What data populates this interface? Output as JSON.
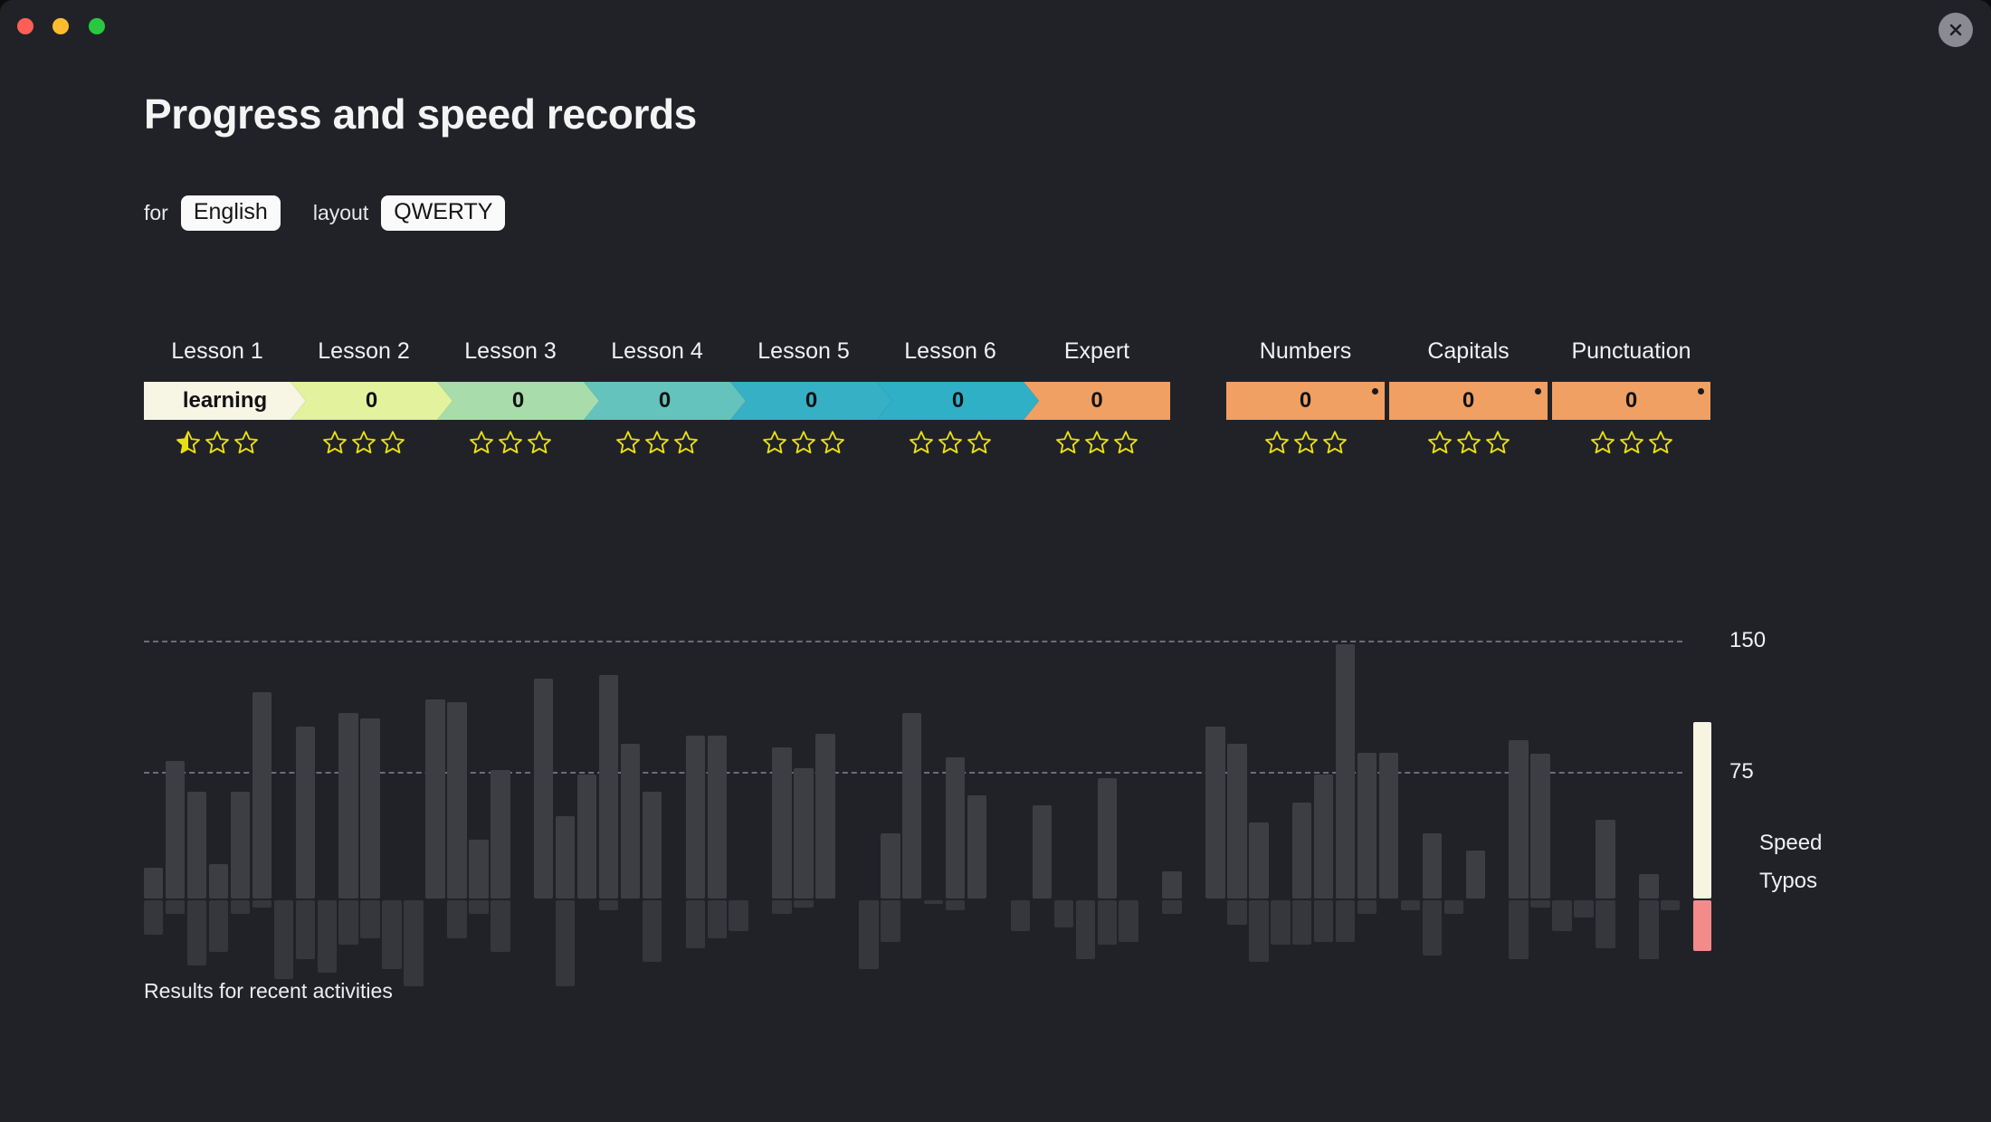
{
  "window": {
    "traffic_lights": [
      {
        "name": "close",
        "color": "#ff5f57"
      },
      {
        "name": "minimize",
        "color": "#febc2e"
      },
      {
        "name": "maximize",
        "color": "#28c840"
      }
    ],
    "close_button_icon": "close-icon"
  },
  "header": {
    "title": "Progress and speed records",
    "for_label": "for",
    "language_value": "English",
    "layout_label": "layout",
    "layout_value": "QWERTY"
  },
  "progress": {
    "items": [
      {
        "label": "Lesson 1",
        "value": "learning",
        "color": "#f7f5e3",
        "shape": "chevron",
        "stars_total": 3,
        "stars_filled": 0.5,
        "dot": false
      },
      {
        "label": "Lesson 2",
        "value": "0",
        "color": "#e3f29c",
        "shape": "chevron",
        "stars_total": 3,
        "stars_filled": 0,
        "dot": false
      },
      {
        "label": "Lesson 3",
        "value": "0",
        "color": "#a9dcab",
        "shape": "chevron",
        "stars_total": 3,
        "stars_filled": 0,
        "dot": false
      },
      {
        "label": "Lesson 4",
        "value": "0",
        "color": "#64c3bd",
        "shape": "chevron",
        "stars_total": 3,
        "stars_filled": 0,
        "dot": false
      },
      {
        "label": "Lesson 5",
        "value": "0",
        "color": "#36b0c4",
        "shape": "chevron",
        "stars_total": 3,
        "stars_filled": 0,
        "dot": false
      },
      {
        "label": "Lesson 6",
        "value": "0",
        "color": "#2fb0c6",
        "shape": "chevron",
        "stars_total": 3,
        "stars_filled": 0,
        "dot": false
      },
      {
        "label": "Expert",
        "value": "0",
        "color": "#f0a063",
        "shape": "chevron-end",
        "stars_total": 3,
        "stars_filled": 0,
        "dot": false
      },
      {
        "label": "Numbers",
        "value": "0",
        "color": "#f0a063",
        "shape": "flat",
        "stars_total": 3,
        "stars_filled": 0,
        "dot": true
      },
      {
        "label": "Capitals",
        "value": "0",
        "color": "#f0a063",
        "shape": "flat",
        "stars_total": 3,
        "stars_filled": 0,
        "dot": true
      },
      {
        "label": "Punctuation",
        "value": "0",
        "color": "#f0a063",
        "shape": "flat",
        "stars_total": 3,
        "stars_filled": 0,
        "dot": true
      }
    ],
    "star_color": "#e8de16"
  },
  "chart_data": {
    "type": "bar",
    "title": "Results for recent activities",
    "xlabel": "",
    "ylabel": "",
    "grid": true,
    "gridlines": [
      150,
      75
    ],
    "ylim": [
      0,
      160
    ],
    "legend_position": "right",
    "series": [
      {
        "name": "Speed",
        "color": "#f7f5e1",
        "bar_color": "#3d3e43",
        "direction": "up",
        "values": [
          18,
          80,
          62,
          20,
          62,
          120,
          0,
          100,
          0,
          108,
          105,
          0,
          0,
          116,
          114,
          34,
          75,
          0,
          128,
          48,
          72,
          130,
          90,
          62,
          0,
          95,
          95,
          0,
          0,
          88,
          76,
          96,
          0,
          0,
          38,
          108,
          0,
          82,
          60,
          0,
          0,
          54,
          0,
          0,
          70,
          0,
          0,
          16,
          0,
          100,
          90,
          44,
          0,
          56,
          72,
          148,
          85,
          85,
          0,
          38,
          0,
          28,
          0,
          92,
          84,
          0,
          0,
          46,
          0,
          14,
          0
        ]
      },
      {
        "name": "Typos",
        "color": "#f48b8b",
        "bar_color": "#36373c",
        "direction": "down",
        "values": [
          20,
          8,
          38,
          30,
          8,
          4,
          46,
          34,
          42,
          26,
          22,
          40,
          50,
          0,
          22,
          8,
          30,
          0,
          0,
          50,
          0,
          6,
          0,
          36,
          0,
          28,
          22,
          18,
          0,
          8,
          4,
          0,
          0,
          40,
          24,
          0,
          2,
          6,
          0,
          0,
          18,
          0,
          16,
          34,
          26,
          24,
          0,
          8,
          0,
          0,
          14,
          36,
          26,
          26,
          24,
          24,
          8,
          0,
          6,
          32,
          8,
          0,
          0,
          34,
          4,
          18,
          10,
          28,
          0,
          34,
          6
        ]
      }
    ],
    "legend": [
      {
        "label": "Speed",
        "color": "#f7f5e1"
      },
      {
        "label": "Typos",
        "color": "#f48b8b"
      }
    ],
    "selected_bar_index": 31,
    "selected_bar_series": "Typos",
    "axis_tick_labels": [
      "150",
      "75"
    ]
  }
}
